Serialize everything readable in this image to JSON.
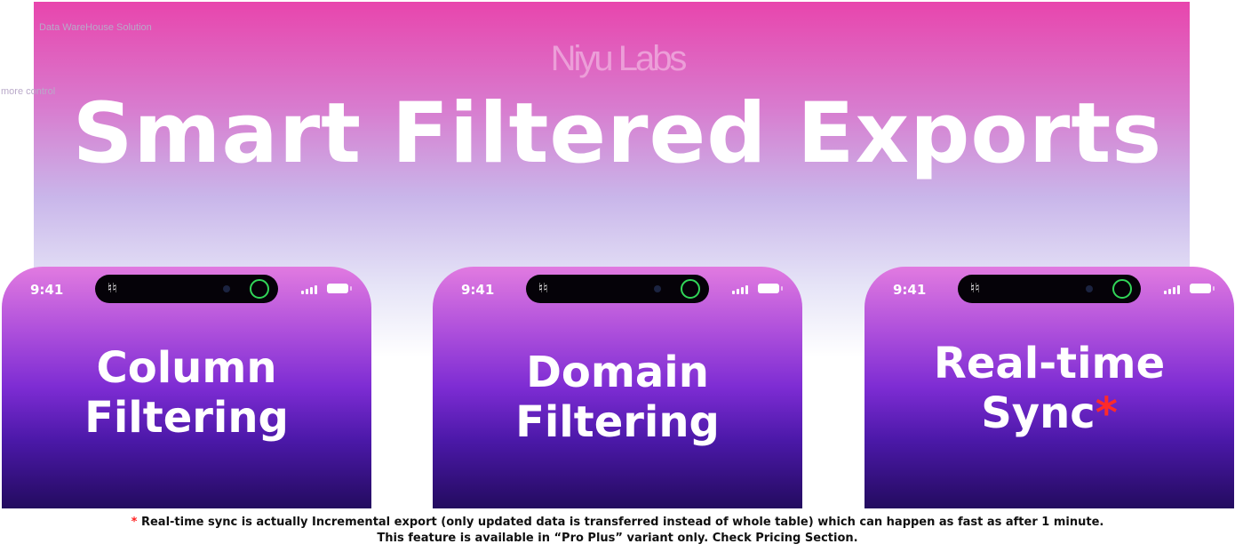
{
  "header": {
    "small_label": "Data WareHouse Solution",
    "side_label": "more control",
    "brand": "Niyu Labs",
    "title": "Smart Filtered Exports"
  },
  "cards": [
    {
      "time": "9:41",
      "title_line1": "Column",
      "title_line2": "Filtering",
      "asterisk": ""
    },
    {
      "time": "9:41",
      "title_line1": "Domain",
      "title_line2": "Filtering",
      "asterisk": ""
    },
    {
      "time": "9:41",
      "title_line1": "Real-time",
      "title_line2": "Sync",
      "asterisk": "*"
    }
  ],
  "footnote": {
    "star": "*",
    "line1": "Real-time sync is actually Incremental export (only updated data is transferred instead of whole table) which can happen as fast as after 1 minute.",
    "line2": "This feature is available in “Pro Plus” variant only. Check Pricing Section."
  },
  "icons": [
    "earbuds-icon",
    "camera-icon",
    "activity-ring-icon",
    "signal-icon",
    "battery-icon"
  ],
  "colors": {
    "accent": "#e845ad",
    "card_top": "#e17ae0",
    "card_bottom": "#230b5f",
    "asterisk": "#ff2a2a"
  }
}
